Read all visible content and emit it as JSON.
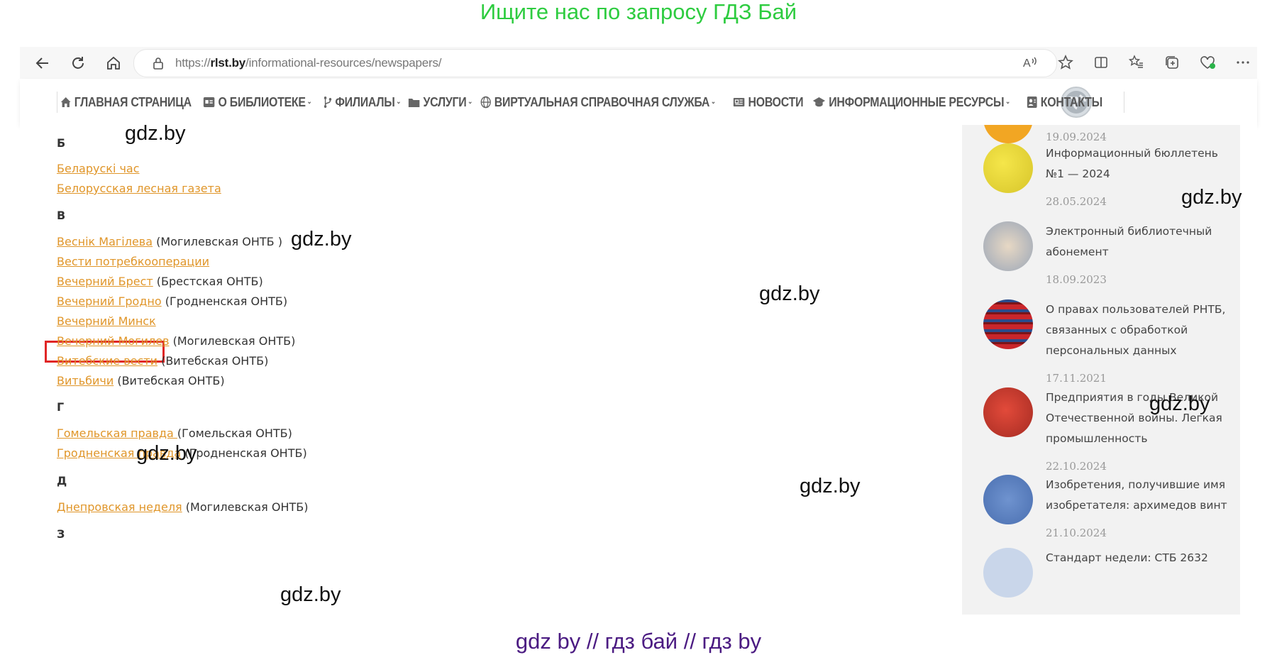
{
  "banner_top": "Ищите нас по запросу ГДЗ Бай",
  "banner_bottom": "gdz by  //  гдз бай  //  гдз by",
  "browser": {
    "url_prefix": "https://",
    "url_host": "rlst.by",
    "url_path": "/informational-resources/newspapers/"
  },
  "nav": {
    "items": [
      {
        "label": "ГЛАВНАЯ СТРАНИЦА",
        "icon": "home-icon"
      },
      {
        "label": "О БИБЛИОТЕКЕ",
        "icon": "id-card-icon",
        "caret": "⌄"
      },
      {
        "label": "ФИЛИАЛЫ",
        "icon": "branch-icon",
        "caret": "⌄"
      },
      {
        "label": "УСЛУГИ",
        "icon": "folder-icon",
        "caret": "⌄"
      },
      {
        "label": "ВИРТУАЛЬНАЯ СПРАВОЧНАЯ СЛУЖБА",
        "icon": "globe-icon",
        "caret": "⌄"
      },
      {
        "label": "НОВОСТИ",
        "icon": "newspaper-icon"
      },
      {
        "label": "ИНФОРМАЦИОННЫЕ РЕСУРСЫ",
        "icon": "graduation-cap-icon",
        "caret": "⌄"
      },
      {
        "label": "КОНТАКТЫ",
        "icon": "contact-card-icon"
      }
    ]
  },
  "list": {
    "letter_b": "Б",
    "b1": "Беларускі час ",
    "b2": "Белорусская лесная газета",
    "letter_v": "В",
    "v1_link": "Веснік Магілева",
    "v1_note": " (Могилевская ОНТБ )",
    "v2_link": "Вести потребкооперации",
    "v3_link": "Вечерний Брест",
    "v3_note": " (Брестская ОНТБ)",
    "v4_link": "Вечерний Гродно",
    "v4_note": " (Гродненская ОНТБ)",
    "v5_link": "Вечерний Минск",
    "v6_link": "Вечерний Могилев",
    "v6_note": " (Могилевская ОНТБ)",
    "v7_link": "Витебские вести",
    "v7_note": " (Витебская ОНТБ)",
    "v8_link": "Витьбичи",
    "v8_note": " (Витебская ОНТБ)",
    "letter_g": "Г",
    "g1_link": "Гомельская правда ",
    "g1_note": "(Гомельская ОНТБ)",
    "g2_link": "Гродненская правда",
    "g2_note": " (Гродненская ОНТБ)",
    "letter_d": "Д",
    "d1_link": "Днепровская неделя",
    "d1_note": " (Могилевская ОНТБ)",
    "letter_z": "З"
  },
  "sidebar": {
    "date0": "19.09.2024",
    "item1_title": "Информационный бюллетень №1 — 2024",
    "item1_date": "28.05.2024",
    "item2_title": "Электронный библиотечный абонемент",
    "item2_date": "18.09.2023",
    "item3_title": "О правах пользователей РНТБ, связанных с обработкой персональных данных",
    "item3_date": "17.11.2021",
    "item4_title": "Предприятия в годы Великой Отечественной войны. Легкая промышленность",
    "item4_date": "22.10.2024",
    "item5_title": "Изобретения, получившие имя изобретателя: архимедов винт",
    "item5_date": "21.10.2024",
    "item6_title": "Стандарт недели: СТБ 2632"
  },
  "watermark": "gdz.by"
}
